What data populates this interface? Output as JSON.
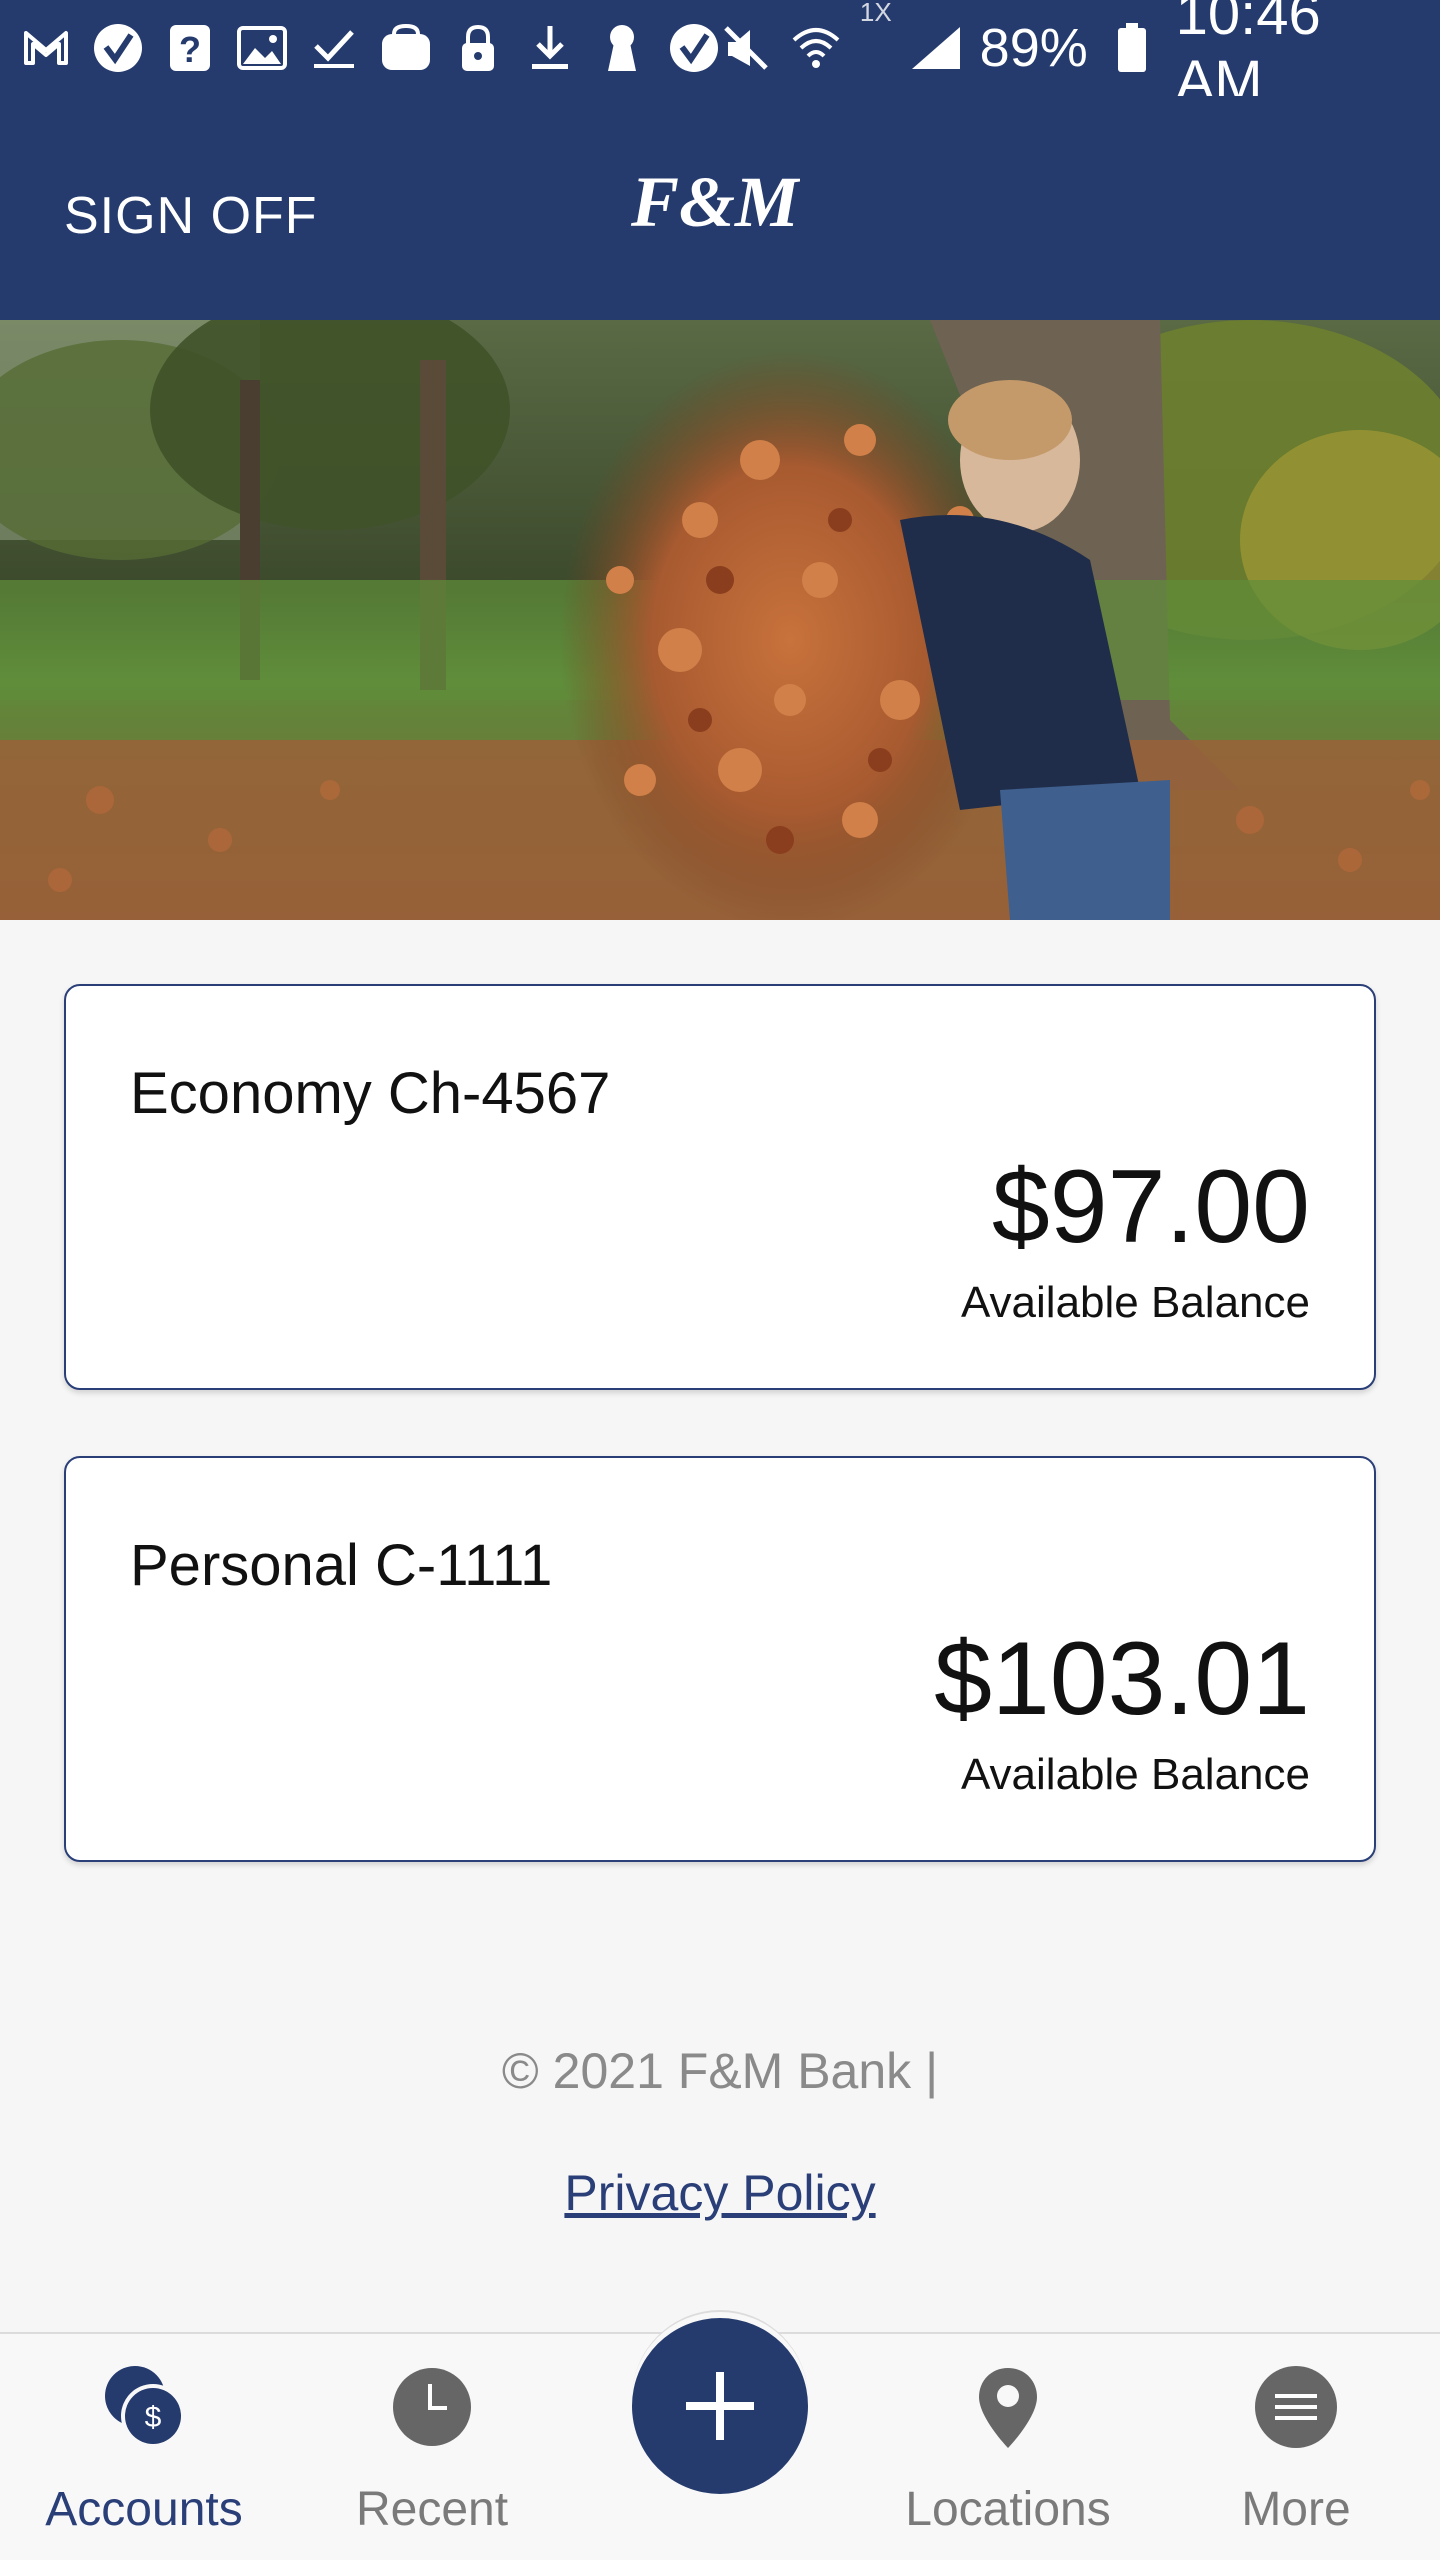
{
  "status_bar": {
    "network_type": "1X",
    "battery": "89%",
    "time": "10:46 AM"
  },
  "header": {
    "sign_off_label": "SIGN OFF",
    "logo_text": "F&M"
  },
  "accounts": [
    {
      "name": "Economy Ch-4567",
      "balance": "$97.00",
      "balance_label": "Available Balance"
    },
    {
      "name": "Personal C-1111",
      "balance": "$103.01",
      "balance_label": "Available Balance"
    }
  ],
  "footer": {
    "copyright": "© 2021 F&M Bank |",
    "privacy_label": "Privacy Policy"
  },
  "bottom_nav": {
    "items": [
      {
        "label": "Accounts",
        "icon": "accounts-icon",
        "active": true
      },
      {
        "label": "Recent",
        "icon": "clock-icon",
        "active": false
      },
      {
        "label": "Locations",
        "icon": "location-pin-icon",
        "active": false
      },
      {
        "label": "More",
        "icon": "menu-icon",
        "active": false
      }
    ],
    "fab_icon": "plus-icon"
  },
  "colors": {
    "brand_navy": "#253b6e",
    "card_border": "#2a3f78",
    "muted_text": "#8a8a8a"
  }
}
